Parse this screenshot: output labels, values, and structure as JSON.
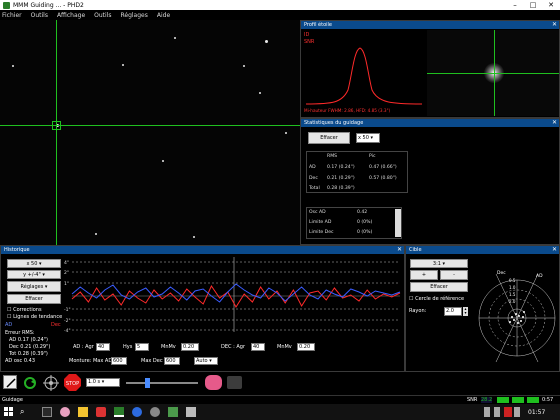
{
  "window": {
    "title": "MMM Guiding ... - PHD2"
  },
  "menu": [
    "Fichier",
    "Outils",
    "Affichage",
    "Outils",
    "Réglages",
    "Aide"
  ],
  "profile_panel": {
    "title": "Profil étoile",
    "readout_lines": [
      "ID",
      "SNR"
    ],
    "footer": "Mi-hauteur FWHM: 2.86, HFD: 4.85 (3.3\")"
  },
  "guiding_panel": {
    "title": "Statistiques du guidage",
    "button_clear": "Effacer",
    "combo_value": "x 50",
    "columns": [
      "",
      "RMS",
      "Pic"
    ],
    "rows": [
      {
        "label": "AD",
        "rms": "0.17 (0.24\")",
        "peak": "0.47 (0.66\")"
      },
      {
        "label": "Dec",
        "rms": "0.21 (0.29\")",
        "peak": "0.57 (0.80\")"
      },
      {
        "label": "Total",
        "rms": "0.28 (0.39\")",
        "peak": ""
      }
    ],
    "small_rows": [
      {
        "label": "Osc AD",
        "value": "0.42"
      },
      {
        "label": "Limite AD",
        "value": "0 (0%)"
      },
      {
        "label": "Limite Dec",
        "value": "0 (0%)"
      }
    ]
  },
  "history_panel": {
    "title": "Historique",
    "btn_zoom": "x 50",
    "btn_scale": "y +/-4\"",
    "btn_settings": "Réglages",
    "btn_clear": "Effacer",
    "check_corrections": "Corrections",
    "check_trendlines": "Lignes de tendance",
    "legend_ra": "AD",
    "legend_dec": "Dec",
    "stats": [
      "Erreur RMS:",
      "AD 0.17 (0.24\")",
      "Dec 0.21 (0.29\")",
      "Tot 0.28 (0.39\")",
      "AD osc 0.43"
    ],
    "y_ticks": [
      "4\"",
      "2\"",
      "1\"",
      "-1\"",
      "-2\"",
      "-4\""
    ],
    "controls": {
      "ra_agr_label": "AD : Agr",
      "ra_agr": "40",
      "hys_label": "Hys",
      "hys": "5",
      "minmv_label": "MnMv",
      "minmv": "0.20",
      "dec_agr_label": "DEC : Agr",
      "dec_agr": "40",
      "dec_minmv_label": "MnMv",
      "dec_minmv": "0.20",
      "scope_label": "Monture: Max AD",
      "max_ra": "600",
      "max_dec_label": "Max Dec",
      "max_dec": "600",
      "mode": "Auto"
    },
    "ra_series": [
      0.2,
      0.9,
      0.3,
      -0.2,
      0.6,
      1.1,
      0.1,
      -0.3,
      0.4,
      0.8,
      -0.1,
      0.2,
      0.9,
      0.3,
      -0.4,
      0.5,
      0.7,
      0.0,
      -0.6,
      0.4,
      1.2,
      0.6,
      0.1,
      -0.2,
      0.8,
      0.3,
      -0.5,
      0.2,
      0.9,
      0.1,
      -0.3,
      0.6,
      0.2,
      -0.1,
      0.7,
      0.4,
      0.0,
      0.5,
      0.3,
      0.1,
      0.4
    ],
    "dec_series": [
      -0.3,
      0.4,
      -0.6,
      0.8,
      -0.4,
      0.2,
      -0.9,
      0.5,
      -0.2,
      -0.7,
      0.6,
      -0.3,
      0.3,
      -0.5,
      0.7,
      -0.1,
      -0.8,
      1.0,
      -0.2,
      0.4,
      -1.1,
      0.2,
      -0.6,
      0.9,
      -0.3,
      0.5,
      -0.7,
      0.6,
      -1.0,
      0.3,
      0.5,
      -0.4,
      0.8,
      -0.2,
      0.1,
      -0.5,
      0.6,
      -0.3,
      0.2,
      -0.1,
      0.3
    ]
  },
  "target_panel": {
    "title": "Cible",
    "btn_zoom_value": "3:1",
    "btn_plus": "+",
    "btn_minus": "-",
    "btn_clear": "Effacer",
    "check_ref": "Cercle de référence",
    "radius_label": "Rayon:",
    "radius_value": "2.0",
    "ring_labels": [
      "0.5",
      "1.0",
      "1.5",
      "2.0"
    ],
    "axis_labels": [
      "Dec",
      "AD"
    ]
  },
  "toolbar": {
    "exposure": "1.0 s"
  },
  "statusbar": {
    "left": "Guidage",
    "snr_label": "SNR",
    "snr_value": "28.2",
    "right_time_label": "0:57"
  },
  "taskbar": {
    "clock_time": "01:57",
    "search_hint": "⌕"
  },
  "colors": {
    "ra": "#3a5cff",
    "dec": "#ff2a2a",
    "header": "#0a4a8c",
    "crosshair": "#1fbf1f"
  }
}
